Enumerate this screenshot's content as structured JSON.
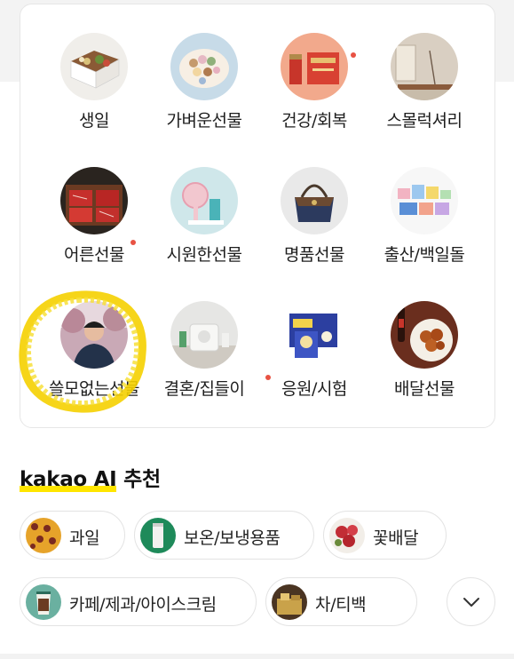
{
  "categories": [
    {
      "label": "생일",
      "icon": "gift-box-icon",
      "new_dot": false
    },
    {
      "label": "가벼운선물",
      "icon": "macaron-icon",
      "new_dot": false
    },
    {
      "label": "건강/회복",
      "icon": "health-supplement-icon",
      "new_dot": true
    },
    {
      "label": "스몰럭셔리",
      "icon": "incense-icon",
      "new_dot": false
    },
    {
      "label": "어른선물",
      "icon": "beef-icon",
      "new_dot": true
    },
    {
      "label": "시원한선물",
      "icon": "fan-icon",
      "new_dot": false
    },
    {
      "label": "명품선물",
      "icon": "handbag-icon",
      "new_dot": false
    },
    {
      "label": "출산/백일돌",
      "icon": "baby-goods-icon",
      "new_dot": false
    },
    {
      "label": "쓸모없는선물",
      "icon": "portrait-icon",
      "new_dot": false
    },
    {
      "label": "결혼/집들이",
      "icon": "appliance-icon",
      "new_dot": true
    },
    {
      "label": "응원/시험",
      "icon": "snack-box-icon",
      "new_dot": false
    },
    {
      "label": "배달선물",
      "icon": "chicken-icon",
      "new_dot": false
    }
  ],
  "ai_section": {
    "brand": "kakao AI",
    "suffix": " 추천",
    "brand_highlight_color": "#ffe600"
  },
  "chips": [
    {
      "label": "과일",
      "icon": "fruit-icon"
    },
    {
      "label": "보온/보냉용품",
      "icon": "tumbler-icon"
    },
    {
      "label": "꽃배달",
      "icon": "flower-icon"
    },
    {
      "label": "카페/제과/아이스크림",
      "icon": "coffee-icon"
    },
    {
      "label": "차/티백",
      "icon": "tea-icon"
    }
  ],
  "more_button": {
    "icon": "chevron-down-icon"
  },
  "colors": {
    "new_dot": "#e85243",
    "highlight_scribble": "#f5d000"
  }
}
